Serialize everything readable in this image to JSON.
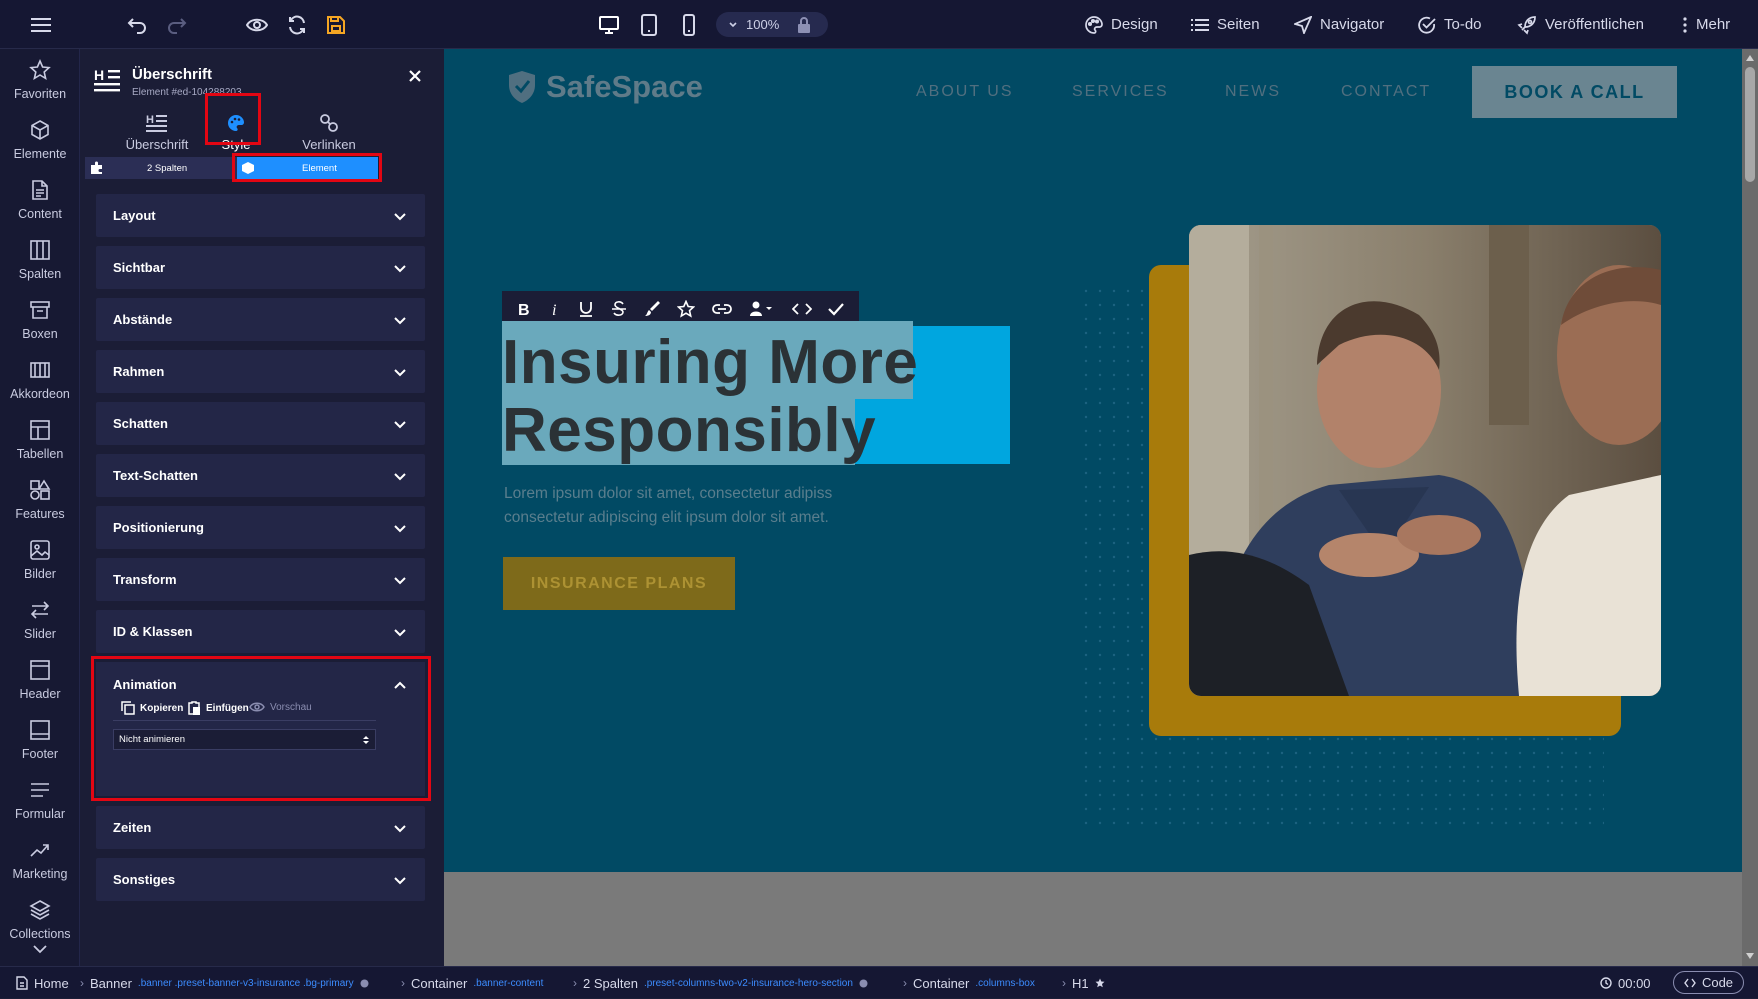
{
  "topbar": {
    "zoom": "100%",
    "menu": [
      {
        "label": "Design",
        "icon": "palette-icon"
      },
      {
        "label": "Seiten",
        "icon": "list-icon"
      },
      {
        "label": "Navigator",
        "icon": "navigation-arrow-icon"
      },
      {
        "label": "To-do",
        "icon": "check-circle-icon"
      },
      {
        "label": "Veröffentlichen",
        "icon": "rocket-icon"
      },
      {
        "label": "Mehr",
        "icon": "more-vertical-icon"
      }
    ]
  },
  "leftnav": [
    {
      "label": "Favoriten",
      "icon": "star-icon"
    },
    {
      "label": "Elemente",
      "icon": "cube-icon"
    },
    {
      "label": "Content",
      "icon": "document-icon"
    },
    {
      "label": "Spalten",
      "icon": "columns-icon"
    },
    {
      "label": "Boxen",
      "icon": "box-icon"
    },
    {
      "label": "Akkordeon",
      "icon": "accordion-icon"
    },
    {
      "label": "Tabellen",
      "icon": "table-icon"
    },
    {
      "label": "Features",
      "icon": "features-icon"
    },
    {
      "label": "Bilder",
      "icon": "image-icon"
    },
    {
      "label": "Slider",
      "icon": "slider-arrows-icon"
    },
    {
      "label": "Header",
      "icon": "header-icon"
    },
    {
      "label": "Footer",
      "icon": "footer-icon"
    },
    {
      "label": "Formular",
      "icon": "form-icon"
    },
    {
      "label": "Marketing",
      "icon": "trend-icon"
    },
    {
      "label": "Collections",
      "icon": "layers-icon"
    }
  ],
  "panel": {
    "title": "Überschrift",
    "element_id": "Element #ed-104288203",
    "tabs": [
      "Überschrift",
      "Style",
      "Verlinken"
    ],
    "scope_tabs": [
      "2 Spalten",
      "Element"
    ],
    "sections_top": [
      "Layout",
      "Sichtbar",
      "Abstände",
      "Rahmen",
      "Schatten",
      "Text-Schatten",
      "Positionierung",
      "Transform",
      "ID & Klassen"
    ],
    "animation": {
      "title": "Animation",
      "copy": "Kopieren",
      "paste": "Einfügen",
      "preview": "Vorschau",
      "select_value": "Nicht animieren"
    },
    "sections_bottom": [
      "Zeiten",
      "Sonstiges"
    ]
  },
  "site": {
    "logo": "SafeSpace",
    "nav": [
      "ABOUT US",
      "SERVICES",
      "NEWS",
      "CONTACT"
    ],
    "cta": "BOOK A CALL",
    "heading_line1": "Insuring More",
    "heading_line2": "Responsibly",
    "paragraph_line1": "Lorem ipsum dolor sit amet, consectetur adipiss",
    "paragraph_line2": "consectetur adipiscing elit ipsum dolor sit amet.",
    "button": "INSURANCE PLANS"
  },
  "breadcrumb": {
    "home": "Home",
    "items": [
      {
        "label": "Banner",
        "classes": ".banner .preset-banner-v3-insurance .bg-primary"
      },
      {
        "label": "Container",
        "classes": ".banner-content"
      },
      {
        "label": "2 Spalten",
        "classes": ".preset-columns-two-v2-insurance-hero-section"
      },
      {
        "label": "Container",
        "classes": ".columns-box"
      },
      {
        "label": "H1",
        "classes": ""
      }
    ],
    "time": "00:00",
    "code": "Code"
  },
  "colors": {
    "accent": "#e30613",
    "hero_bg": "#014a64",
    "gold": "#a87b0b",
    "highlight": "#00a6df",
    "active_tab": "#1e8fff"
  }
}
